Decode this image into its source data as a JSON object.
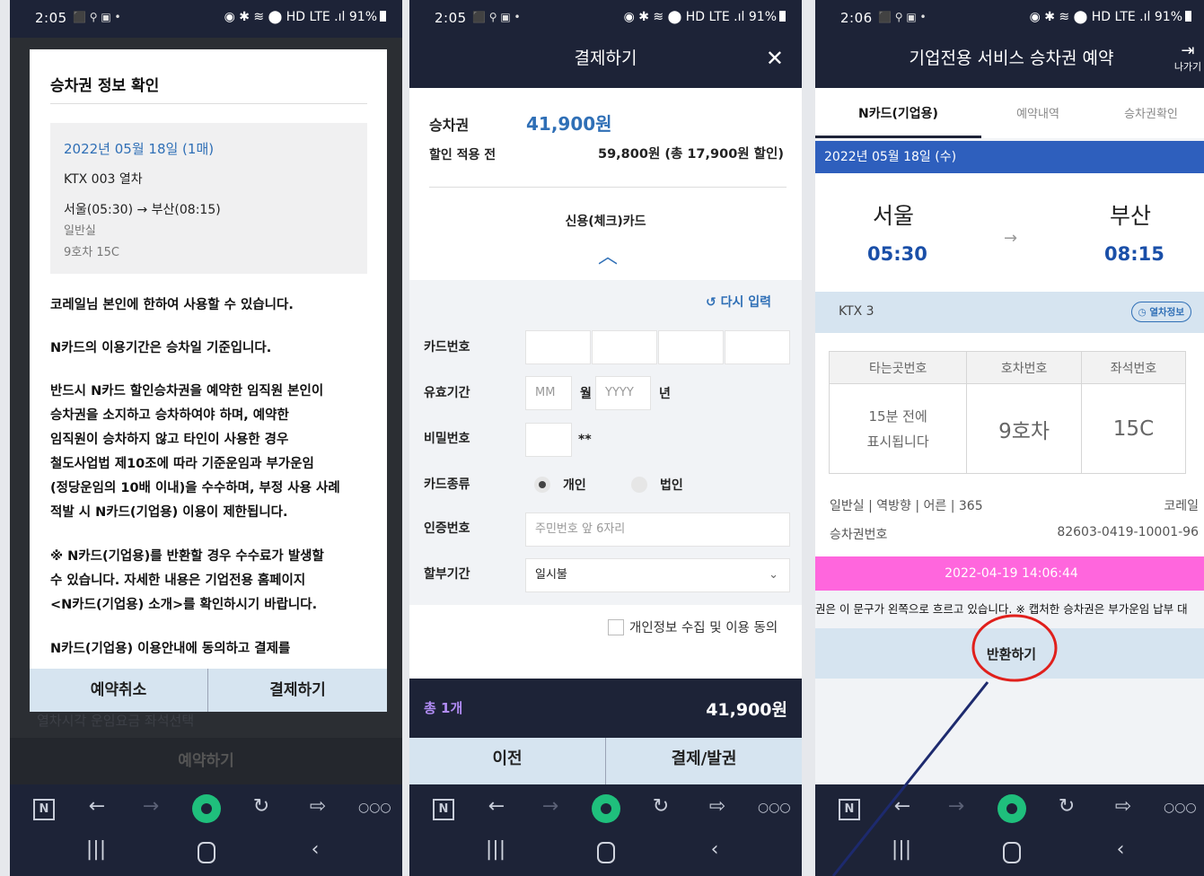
{
  "status": {
    "time1": "2:05",
    "time2": "2:05",
    "time3": "2:06",
    "battery": "91%",
    "icons": "⬛ ⚲ ▣ •",
    "right_icons": "◉ ✱ ≋ ⬤ HD LTE .ıl"
  },
  "screen1": {
    "title": "승차권 정보 확인",
    "date": "2022년 05월 18일 (1매)",
    "train": "KTX 003 열차",
    "route": "서울(05:30) → 부산(08:15)",
    "class": "일반실",
    "seat": "9호차 15C",
    "p1": "코레일님 본인에 한하여 사용할 수 있습니다.",
    "p2": "N카드의 이용기간은 승차일 기준입니다.",
    "p3_lines": [
      "반드시 N카드 할인승차권을 예약한 임직원 본인이",
      "승차권을 소지하고 승차하여야 하며, 예약한",
      "임직원이 승차하지 않고 타인이 사용한 경우",
      "철도사업법 제10조에 따라 기준운임과 부가운임",
      "(정당운임의 10배 이내)을 수수하며, 부정 사용 사례",
      "적발 시 N카드(기업용) 이용이 제한됩니다."
    ],
    "p4_lines": [
      "※ N카드(기업용)를 반환할 경우 수수료가 발생할",
      "수 있습니다. 자세한 내용은 기업전용 홈페이지",
      "<N카드(기업용) 소개>를 확인하시기 바랍니다."
    ],
    "p5": "N카드(기업용) 이용안내에 동의하고 결제를",
    "cancel": "예약취소",
    "pay": "결제하기",
    "behind": "열차시각        운임요금        좌석선택",
    "reserve": "예약하기"
  },
  "screen2": {
    "title": "결제하기",
    "ticket_label": "승차권",
    "ticket_price": "41,900원",
    "before_label": "할인 적용 전",
    "before_price": "59,800원 (총 17,900원 할인)",
    "method": "신용(체크)카드",
    "reenter": "다시 입력",
    "card_no": "카드번호",
    "expiry": "유효기간",
    "mm": "MM",
    "month": "월",
    "yyyy": "YYYY",
    "year": "년",
    "pw": "비밀번호",
    "pw_mask": "**",
    "card_type": "카드종류",
    "personal": "개인",
    "corp": "법인",
    "auth": "인증번호",
    "auth_ph": "주민번호 앞 6자리",
    "install": "할부기간",
    "install_val": "일시불",
    "agree": "개인정보 수집 및 이용 동의",
    "total_label": "총 1개",
    "total_price": "41,900원",
    "prev": "이전",
    "issue": "결제/발권"
  },
  "screen3": {
    "title": "기업전용 서비스 승차권 예약",
    "exit": "나가기",
    "tabs": [
      "N카드(기업용)",
      "예약내역",
      "승차권확인"
    ],
    "date": "2022년 05월 18일 (수)",
    "from": "서울",
    "to": "부산",
    "dep": "05:30",
    "arr": "08:15",
    "train": "KTX 3",
    "train_info": "열차정보",
    "headers": [
      "타는곳번호",
      "호차번호",
      "좌석번호"
    ],
    "platform": "15분 전에\n표시됩니다",
    "car": "9호차",
    "seat": "15C",
    "meta": "일반실 | 역방향 | 어른 | 365",
    "owner": "코레일",
    "ticket_no_label": "승차권번호",
    "ticket_no": "82603-0419-10001-96",
    "timestamp": "2022-04-19 14:06:44",
    "marquee": "권은 이 문구가 왼쪽으로 흐르고 있습니다. ※ 캡처한 승차권은 부가운임 납부 대",
    "return": "반환하기"
  },
  "colors": {
    "navy": "#1d2337",
    "light_blue": "#d6e4f0",
    "accent_blue": "#2f6fb6",
    "pink": "#ff66dd",
    "annotation_red": "#e0201c"
  }
}
